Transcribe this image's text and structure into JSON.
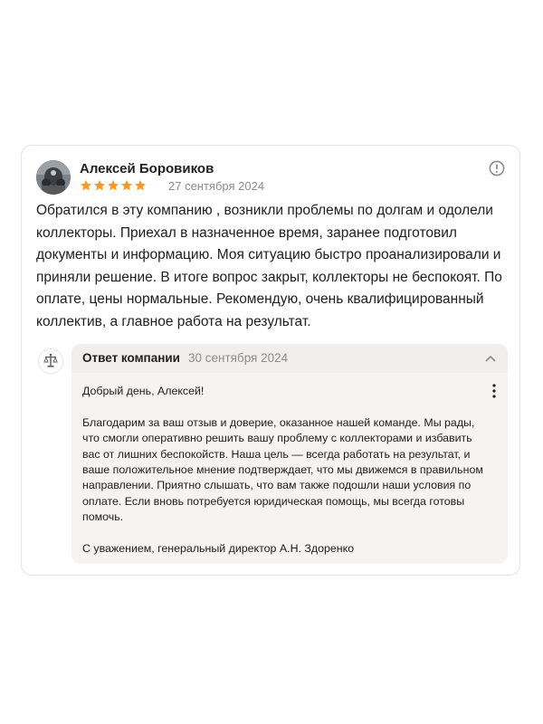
{
  "review": {
    "author": "Алексей Боровиков",
    "rating": 5,
    "rating_max": 5,
    "date": "27 сентября 2024",
    "text": "Обратился в эту компанию , возникли проблемы по долгам и одолели коллекторы. Приехал в назначенное время, заранее подготовил документы и информацию. Моя ситуацию быстро проанализировали и приняли решение. В итоге вопрос закрыт, коллекторы не беспокоят. По оплате, цены нормальные. Рекомендую, очень квалифицированный коллектив, а главное работа на результат."
  },
  "reply": {
    "title": "Ответ компании",
    "date": "30 сентября 2024",
    "greeting": "Добрый день, Алексей!",
    "body": "Благодарим за ваш отзыв и доверие, оказанное нашей команде. Мы рады, что смогли оперативно решить вашу проблему с коллекторами и избавить вас от лишних беспокойств. Наша цель — всегда работать на результат, и ваше положительное мнение подтверждает, что мы движемся в правильном направлении. Приятно слышать, что вам также подошли наши условия по оплате. Если вновь потребуется юридическая помощь, мы всегда готовы помочь.",
    "signature": "С уважением, генеральный директор А.Н. Здоренко"
  },
  "colors": {
    "star": "#fc9b1b",
    "secondary_text": "#8c8c8c",
    "reply_bg": "#f5f4f2",
    "border": "#e4e4e4"
  },
  "icons": {
    "report": "exclamation-circle-icon",
    "collapse": "chevron-up-icon",
    "more": "vertical-dots-icon"
  }
}
